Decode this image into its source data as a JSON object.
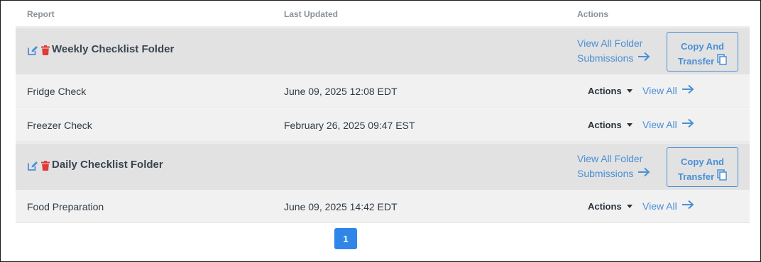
{
  "table": {
    "columns": {
      "report": "Report",
      "last_updated": "Last Updated",
      "actions": "Actions"
    },
    "folders": [
      {
        "title": "Weekly Checklist Folder",
        "view_all_line1": "View All Folder",
        "view_all_line2": "Submissions",
        "copy_line1": "Copy And",
        "copy_line2": "Transfer",
        "reports": [
          {
            "name": "Fridge Check",
            "last_updated": "June 09, 2025 12:08 EDT",
            "actions_label": "Actions",
            "view_all_label": "View All"
          },
          {
            "name": "Freezer Check",
            "last_updated": "February 26, 2025 09:47 EST",
            "actions_label": "Actions",
            "view_all_label": "View All"
          }
        ]
      },
      {
        "title": "Daily Checklist Folder",
        "view_all_line1": "View All Folder",
        "view_all_line2": "Submissions",
        "copy_line1": "Copy And",
        "copy_line2": "Transfer",
        "reports": [
          {
            "name": "Food Preparation",
            "last_updated": "June 09, 2025 14:42 EDT",
            "actions_label": "Actions",
            "view_all_label": "View All"
          }
        ]
      }
    ]
  },
  "pagination": {
    "current_page": "1"
  },
  "icons": {
    "edit": "edit-icon",
    "delete": "trash-icon",
    "arrow": "arrow-right-icon",
    "copy": "copy-icon",
    "caret": "caret-down-icon"
  },
  "colors": {
    "link": "#4a8fd6",
    "delete": "#e03a3a",
    "folder_bg": "#e2e2e2",
    "row_bg": "#f1f1f1",
    "page_active": "#2f86e8"
  }
}
